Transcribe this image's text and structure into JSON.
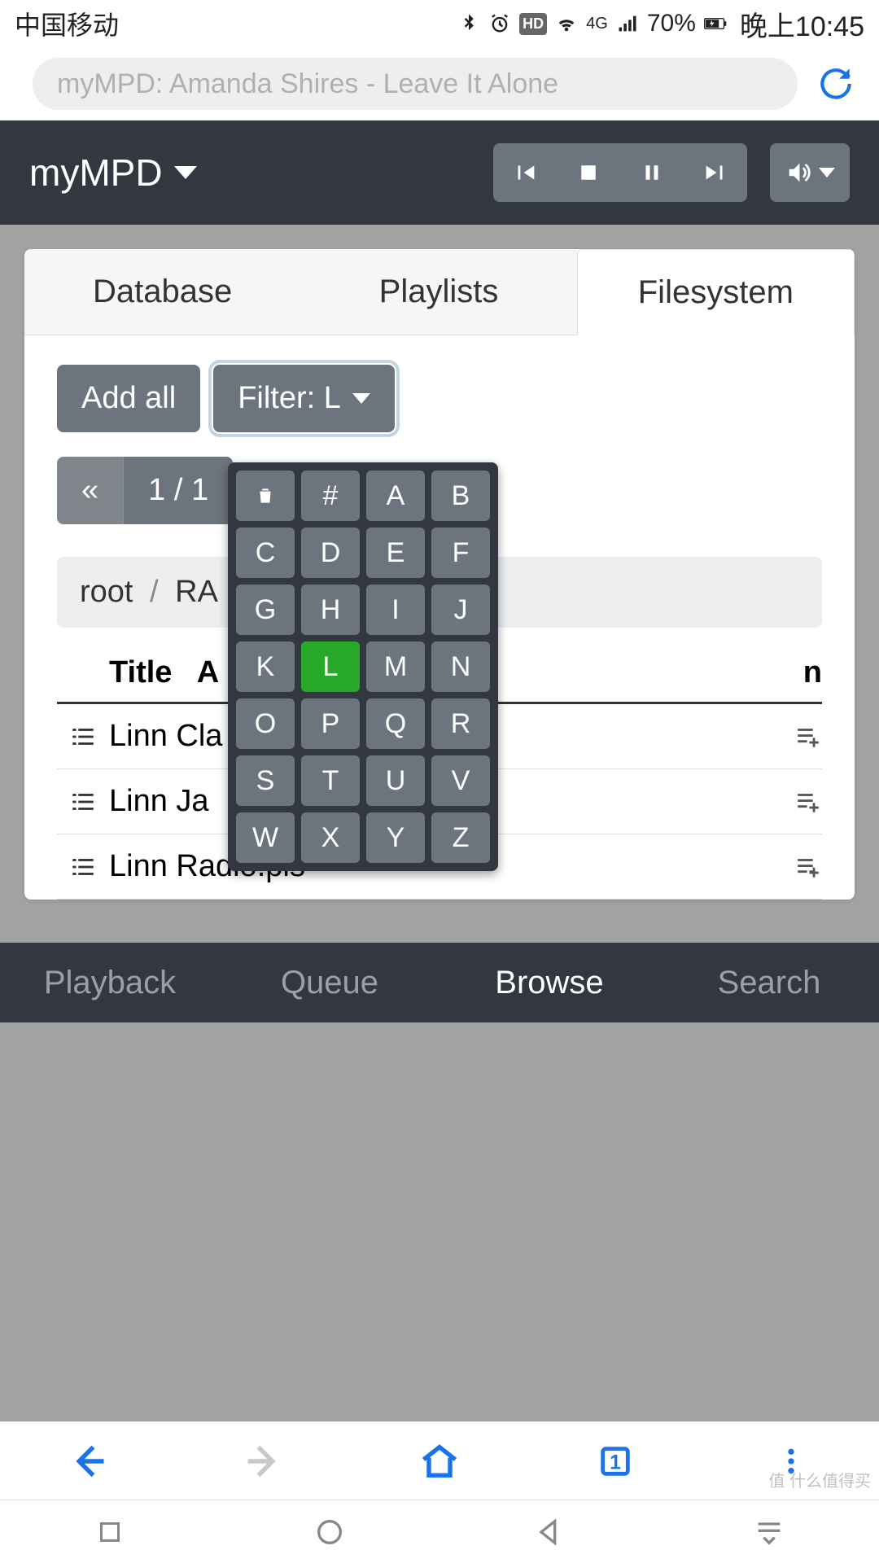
{
  "status": {
    "carrier": "中国移动",
    "network_label": "4G",
    "battery": "70%",
    "time": "晚上10:45"
  },
  "url_bar": {
    "placeholder": "myMPD: Amanda Shires - Leave It Alone"
  },
  "header": {
    "brand": "myMPD"
  },
  "tabs_top": [
    {
      "label": "Database",
      "active": false
    },
    {
      "label": "Playlists",
      "active": false
    },
    {
      "label": "Filesystem",
      "active": true
    }
  ],
  "toolbar": {
    "add_all": "Add all",
    "filter_label": "Filter: L",
    "pager_prev": "«",
    "pager_current": "1 / 1"
  },
  "breadcrumb": {
    "root": "root",
    "next": "RA"
  },
  "table": {
    "headers": {
      "title": "Title",
      "col2": "A",
      "col_last": "n"
    },
    "rows": [
      {
        "title": "Linn Cla"
      },
      {
        "title": "Linn Ja"
      },
      {
        "title": "Linn Radio.pls"
      }
    ]
  },
  "filter_popup": {
    "selected": "L",
    "keys": [
      "trash",
      "#",
      "A",
      "B",
      "C",
      "D",
      "E",
      "F",
      "G",
      "H",
      "I",
      "J",
      "K",
      "L",
      "M",
      "N",
      "O",
      "P",
      "Q",
      "R",
      "S",
      "T",
      "U",
      "V",
      "W",
      "X",
      "Y",
      "Z"
    ]
  },
  "tabs_bottom": [
    {
      "label": "Playback",
      "active": false
    },
    {
      "label": "Queue",
      "active": false
    },
    {
      "label": "Browse",
      "active": true
    },
    {
      "label": "Search",
      "active": false
    }
  ],
  "browser_bar": {
    "tab_count": "1"
  },
  "watermark": "值 什么值得买"
}
